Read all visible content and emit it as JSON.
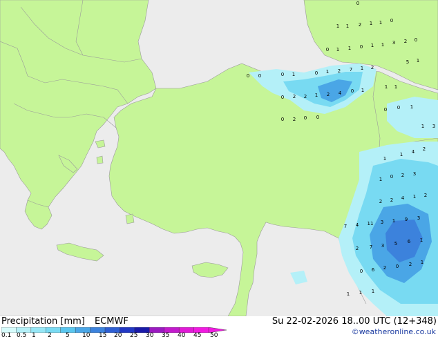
{
  "header": {
    "title": "Precipitation [mm]",
    "model": "ECMWF",
    "valid_time": "Su 22-02-2026 18..00 UTC (12+348)"
  },
  "footer": {
    "copyright": "©weatheronline.co.uk"
  },
  "legend": {
    "ticks": [
      "0.1",
      "0.5",
      "1",
      "2",
      "5",
      "10",
      "15",
      "20",
      "25",
      "30",
      "35",
      "40",
      "45",
      "50"
    ],
    "colors": [
      "#d6fbfb",
      "#b4f0f8",
      "#96e6f5",
      "#78daf2",
      "#5ac6ee",
      "#4aa6e6",
      "#3c82dc",
      "#2e5ed2",
      "#2238c4",
      "#1a1aa8",
      "#9a1ac0",
      "#c21acc",
      "#e01ad6",
      "#f01ae0"
    ]
  },
  "colors": {
    "land": "#c6f598",
    "sea": "#ececec",
    "border": "#9a9a9a",
    "precip_light": "#b4f0f8",
    "precip_mid": "#78daf2",
    "precip_heavy": "#3c82dc"
  },
  "precip_labels": [
    "0",
    "1",
    "1",
    "2",
    "1",
    "1",
    "0",
    "0",
    "1",
    "1",
    "0",
    "1",
    "1",
    "3",
    "2",
    "0",
    "5",
    "1",
    "0",
    "0",
    "0",
    "1",
    "0",
    "1",
    "2",
    "7",
    "1",
    "2",
    "0",
    "2",
    "2",
    "1",
    "2",
    "4",
    "0",
    "1",
    "1",
    "1",
    "0",
    "2",
    "0",
    "0",
    "0",
    "0",
    "1",
    "1",
    "3",
    "1",
    "1",
    "4",
    "2",
    "1",
    "0",
    "2",
    "3",
    "2",
    "2",
    "4",
    "1",
    "2",
    "7",
    "4",
    "11",
    "3",
    "1",
    "9",
    "3",
    "2",
    "7",
    "3",
    "5",
    "6",
    "1",
    "0",
    "6",
    "2",
    "0",
    "2",
    "1",
    "1",
    "1",
    "1"
  ]
}
